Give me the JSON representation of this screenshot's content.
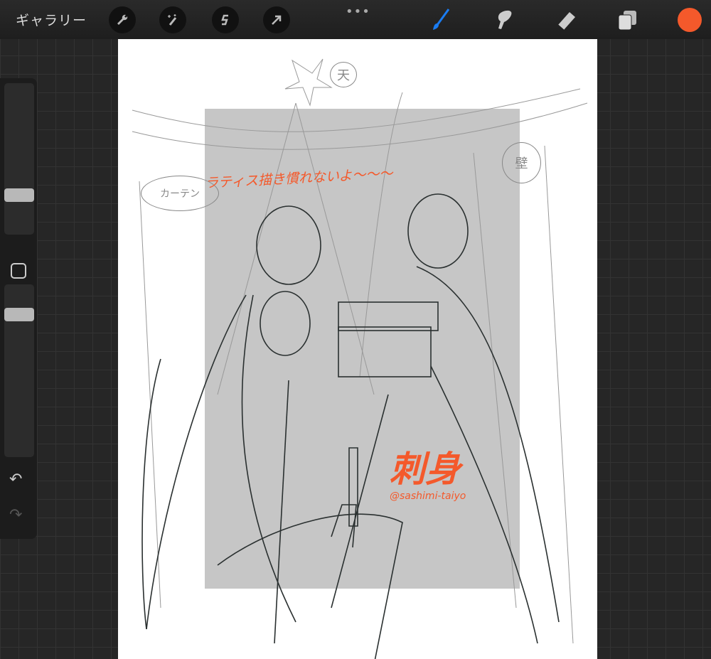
{
  "topbar": {
    "gallery": "ギャラリー",
    "more": "•••",
    "tools": [
      "wrench-icon",
      "magic-wand-icon",
      "selection-icon",
      "transform-arrow-icon"
    ],
    "right_tools": [
      "brush-icon",
      "smudge-icon",
      "eraser-icon",
      "layers-icon"
    ],
    "current_color": "#f4592b",
    "brush_active_color": "#1a7cf2"
  },
  "sidebar": {
    "brush_size_level": 0.28,
    "opacity_level": 0.16
  },
  "canvas": {
    "note": "ラティス描き慣れないよ〜〜〜",
    "labels": {
      "heaven": "天",
      "wall": "壁",
      "curtain": "カーテン"
    },
    "watermark": "刺身",
    "watermark_handle": "@sashimi-taiyo"
  }
}
